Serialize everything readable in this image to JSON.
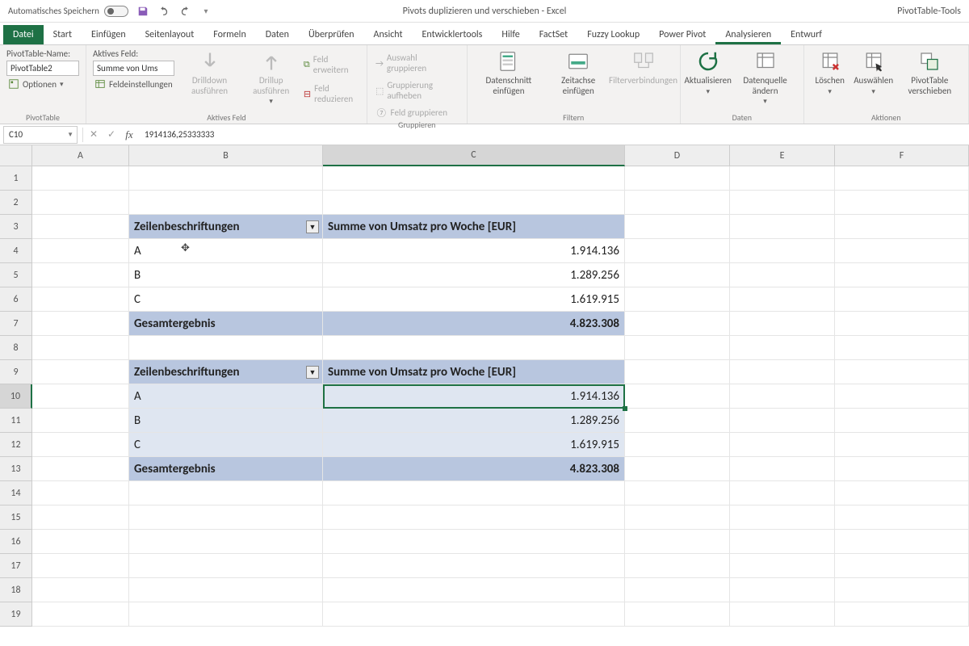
{
  "titlebar": {
    "autosave": "Automatisches Speichern",
    "doc_title": "Pivots duplizieren und verschieben - Excel",
    "context_tools": "PivotTable-Tools"
  },
  "tabs": {
    "file": "Datei",
    "items": [
      "Start",
      "Einfügen",
      "Seitenlayout",
      "Formeln",
      "Daten",
      "Überprüfen",
      "Ansicht",
      "Entwicklertools",
      "Hilfe",
      "FactSet",
      "Fuzzy Lookup",
      "Power Pivot",
      "Analysieren",
      "Entwurf"
    ],
    "active_index": 12
  },
  "ribbon": {
    "group_pivottable": {
      "label": "PivotTable",
      "name_label": "PivotTable-Name:",
      "name_value": "PivotTable2",
      "options": "Optionen"
    },
    "group_activefield": {
      "label": "Aktives Feld",
      "field_label": "Aktives Feld:",
      "field_value": "Summe von Ums",
      "settings": "Feldeinstellungen",
      "drilldown": "Drilldown ausführen",
      "drillup": "Drillup ausführen",
      "expand": "Feld erweitern",
      "reduce": "Feld reduzieren"
    },
    "group_group": {
      "label": "Gruppieren",
      "sel": "Auswahl gruppieren",
      "ungroup": "Gruppierung aufheben",
      "field": "Feld gruppieren"
    },
    "group_filter": {
      "label": "Filtern",
      "slicer": "Datenschnitt einfügen",
      "timeline": "Zeitachse einfügen",
      "conn": "Filterverbindungen"
    },
    "group_data": {
      "label": "Daten",
      "refresh": "Aktualisieren",
      "source": "Datenquelle ändern"
    },
    "group_actions": {
      "label": "Aktionen",
      "clear": "Löschen",
      "select": "Auswählen",
      "move": "PivotTable verschieben"
    }
  },
  "formulabar": {
    "name_box": "C10",
    "formula": "1914136,25333333"
  },
  "grid": {
    "columns": [
      "A",
      "B",
      "C",
      "D",
      "E",
      "F"
    ],
    "selected_col_index": 2,
    "selected_row_index": 9,
    "pivot1": {
      "hdr_row_labels": "Zeilenbeschriftungen",
      "hdr_values": "Summe von Umsatz pro Woche [EUR]",
      "rows": [
        {
          "label": "A",
          "value": "1.914.136"
        },
        {
          "label": "B",
          "value": "1.289.256"
        },
        {
          "label": "C",
          "value": "1.619.915"
        }
      ],
      "total_label": "Gesamtergebnis",
      "total_value": "4.823.308"
    },
    "pivot2": {
      "hdr_row_labels": "Zeilenbeschriftungen",
      "hdr_values": "Summe von Umsatz pro Woche [EUR]",
      "rows": [
        {
          "label": "A",
          "value": "1.914.136"
        },
        {
          "label": "B",
          "value": "1.289.256"
        },
        {
          "label": "C",
          "value": "1.619.915"
        }
      ],
      "total_label": "Gesamtergebnis",
      "total_value": "4.823.308"
    }
  }
}
